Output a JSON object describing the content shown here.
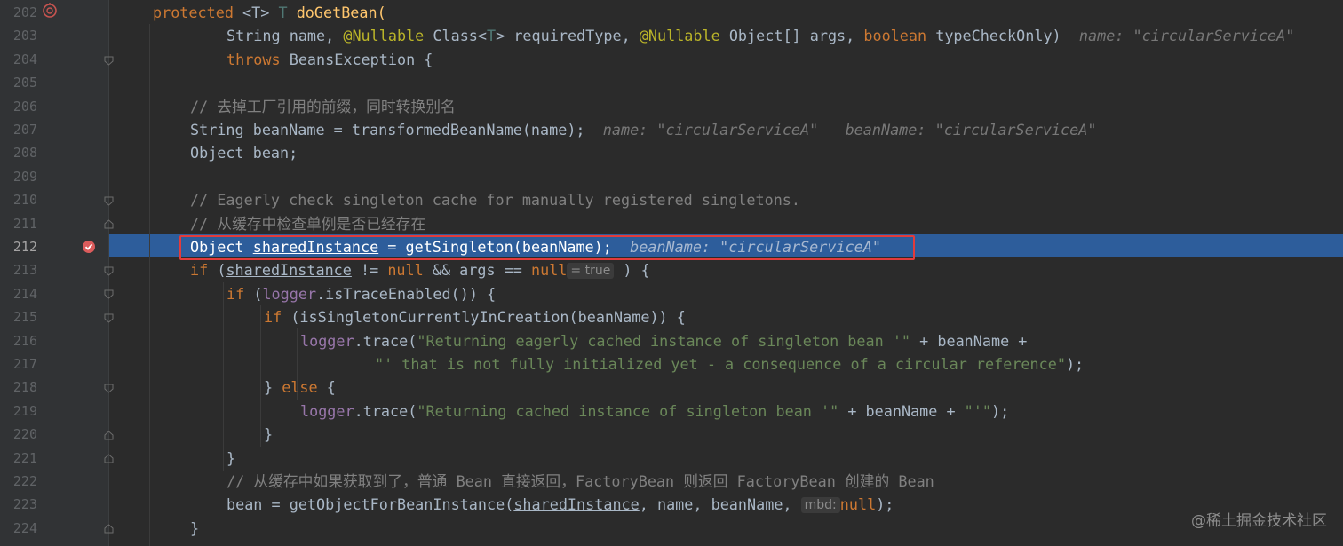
{
  "editor": {
    "file_method": "doGetBean",
    "current_line": 212,
    "lines": [
      {
        "num": "202"
      },
      {
        "num": "203"
      },
      {
        "num": "204"
      },
      {
        "num": "205"
      },
      {
        "num": "206"
      },
      {
        "num": "207"
      },
      {
        "num": "208"
      },
      {
        "num": "209"
      },
      {
        "num": "210"
      },
      {
        "num": "211"
      },
      {
        "num": "212"
      },
      {
        "num": "213"
      },
      {
        "num": "214"
      },
      {
        "num": "215"
      },
      {
        "num": "216"
      },
      {
        "num": "217"
      },
      {
        "num": "218"
      },
      {
        "num": "219"
      },
      {
        "num": "220"
      },
      {
        "num": "221"
      },
      {
        "num": "222"
      },
      {
        "num": "223"
      },
      {
        "num": "224"
      }
    ],
    "tokens": {
      "protected": "protected",
      "generic_T": "<T>",
      "T": "T",
      "doGetBean": "doGetBean(",
      "l203_a": "String name, ",
      "nullable": "@Nullable",
      "l203_b": " Class<",
      "l203_c": "> requiredType, ",
      "l203_d": " Object[] args, ",
      "boolean": "boolean",
      "l203_e": " typeCheckOnly)",
      "hint_203": "name: \"circularServiceA\"",
      "throws": "throws",
      "l204": " BeansException {",
      "c206": "// 去掉工厂引用的前缀，同时转换别名",
      "l207": "String beanName = transformedBeanName(name);",
      "hint_207a": "name: \"circularServiceA\"",
      "hint_207b": "beanName: \"circularServiceA\"",
      "l208": "Object bean;",
      "c210": "// Eagerly check singleton cache for manually registered singletons.",
      "c211": "// 从缓存中检查单例是否已经存在",
      "l212_a": "Object ",
      "sharedInstance": "sharedInstance",
      "l212_b": " = getSingleton(beanName);",
      "hint_212": "beanName: \"circularServiceA\"",
      "if": "if",
      "l213_a": " (",
      "l213_b": " != ",
      "null": "null",
      "l213_c": " && args == ",
      "inlay_true": "= true",
      "l213_d": " ) {",
      "logger": "logger",
      "l214": ".isTraceEnabled()) {",
      "l215": " (isSingletonCurrentlyInCreation(beanName)) {",
      "trace": ".trace(",
      "s216": "\"Returning eagerly cached instance of singleton bean '\"",
      "l216_b": " + beanName +",
      "s217": "\"' that is not fully initialized yet - a consequence of a circular reference\"",
      "l217_b": ");",
      "l218_a": "} ",
      "else": "else",
      "l218_b": " {",
      "s219": "\"Returning cached instance of singleton bean '\"",
      "l219_b": " + beanName + ",
      "s219b": "\"'\"",
      "l219_c": ");",
      "brace": "}",
      "c222": "// 从缓存中如果获取到了，普通 Bean 直接返回，FactoryBean 则返回 FactoryBean 创建的 Bean",
      "l223_a": "bean = getObjectForBeanInstance(",
      "l223_b": ", name, beanName, ",
      "inlay_mbd": "mbd:",
      "l223_c": ");",
      "semicolon": ";"
    }
  },
  "watermark": "@稀土掘金技术社区",
  "colors": {
    "background": "#2b2b2b",
    "keyword": "#cc7832",
    "string": "#6a8759",
    "comment": "#808080",
    "execution_line": "#2d5d9b",
    "breakpoint_box": "#e23b3b"
  }
}
